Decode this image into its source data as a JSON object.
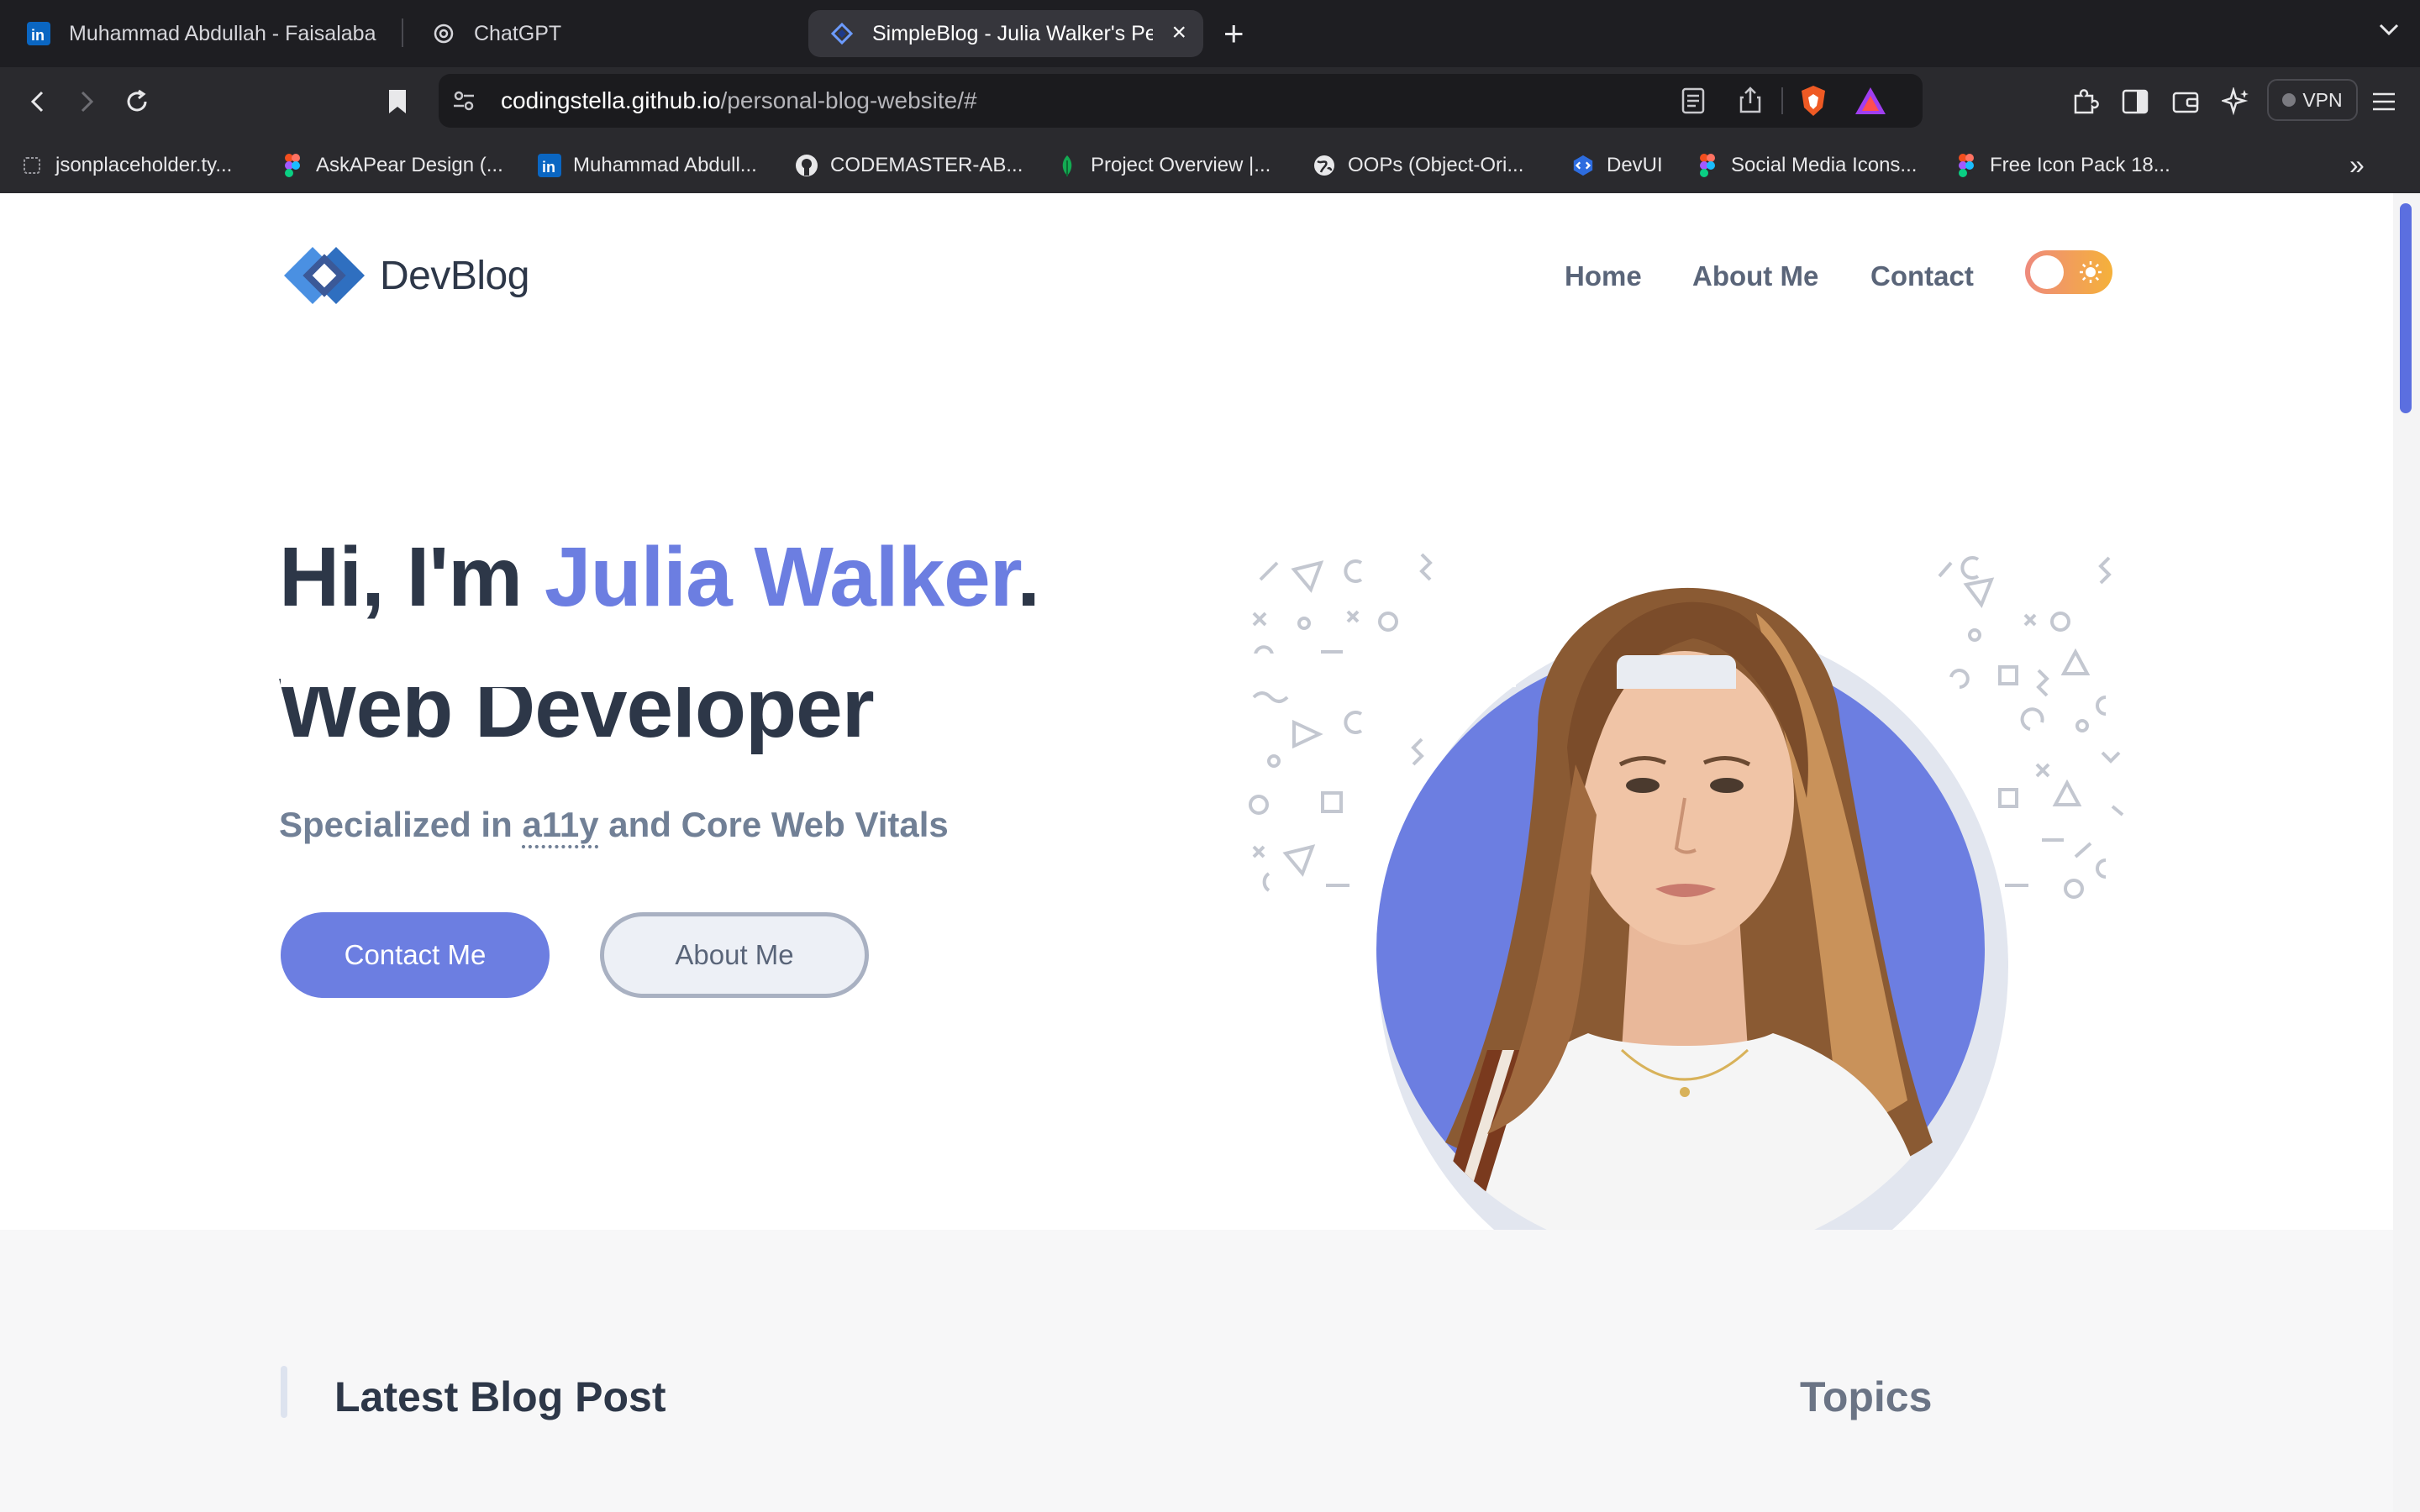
{
  "browser": {
    "tabs": [
      {
        "title": "Muhammad Abdullah - Faisalabad",
        "icon": "linkedin-icon"
      },
      {
        "title": "ChatGPT",
        "icon": "chatgpt-icon"
      },
      {
        "title": "SimpleBlog - Julia Walker's Personal Blog",
        "icon": "devblog-icon",
        "active": true
      }
    ],
    "new_tab": "+",
    "url_host": "codingstella.github.io",
    "url_path": "/personal-blog-website/#",
    "vpn_label": "VPN",
    "bookmarks": [
      {
        "label": "jsonplaceholder.ty...",
        "icon": "page-icon"
      },
      {
        "label": "AskAPear Design (...",
        "icon": "figma-icon"
      },
      {
        "label": "Muhammad Abdull...",
        "icon": "linkedin-icon"
      },
      {
        "label": "CODEMASTER-AB...",
        "icon": "github-icon"
      },
      {
        "label": "Project Overview |...",
        "icon": "leaf-icon"
      },
      {
        "label": "OOPs (Object-Ori...",
        "icon": "globe-icon"
      },
      {
        "label": "DevUI",
        "icon": "devui-icon"
      },
      {
        "label": "Social Media Icons...",
        "icon": "figma-icon"
      },
      {
        "label": "Free Icon Pack 18...",
        "icon": "figma-icon"
      }
    ],
    "bookmarks_more": "»"
  },
  "site": {
    "logo_text": "DevBlog",
    "nav": {
      "home": "Home",
      "about": "About Me",
      "contact": "Contact"
    },
    "theme_toggle": "light"
  },
  "hero": {
    "greeting": "Hi, I'm ",
    "name": "Julia Walker",
    "period": ".",
    "role": "Web Developer",
    "subtitle_prefix": "Specialized in ",
    "subtitle_abbr": "a11y",
    "subtitle_suffix": " and Core Web Vitals",
    "cta_primary": "Contact Me",
    "cta_secondary": "About Me"
  },
  "latest": {
    "title": "Latest Blog Post",
    "topics_title": "Topics"
  },
  "colors": {
    "accent": "#6c7ee1",
    "heading": "#2d3748",
    "muted": "#718096",
    "toggle_start": "#ee8a7d",
    "toggle_end": "#f5b13a"
  }
}
